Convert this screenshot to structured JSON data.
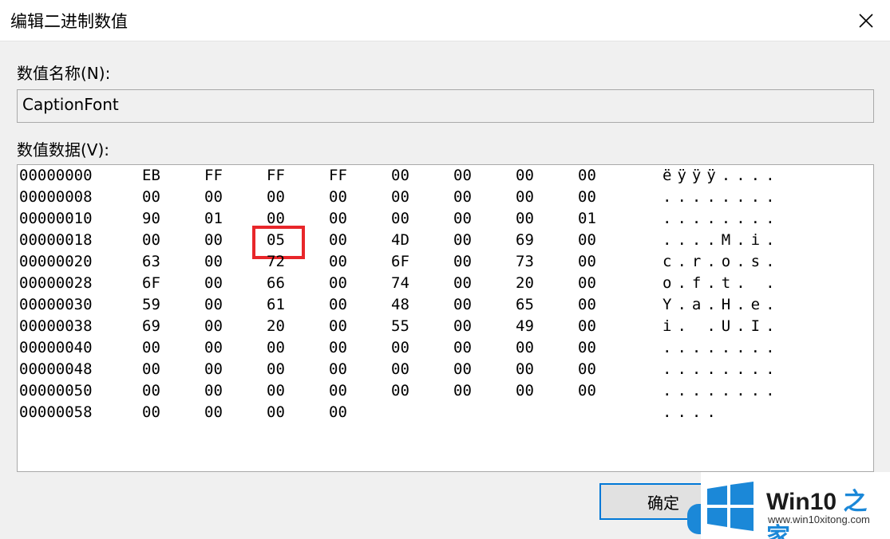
{
  "window": {
    "title": "编辑二进制数值"
  },
  "value_name": {
    "label": "数值名称(N):",
    "value": "CaptionFont"
  },
  "value_data": {
    "label": "数值数据(V):"
  },
  "hex_rows": [
    {
      "addr": "00000000",
      "bytes": [
        "EB",
        "FF",
        "FF",
        "FF",
        "00",
        "00",
        "00",
        "00"
      ],
      "ascii": "ëÿÿÿ...."
    },
    {
      "addr": "00000008",
      "bytes": [
        "00",
        "00",
        "00",
        "00",
        "00",
        "00",
        "00",
        "00"
      ],
      "ascii": "........"
    },
    {
      "addr": "00000010",
      "bytes": [
        "90",
        "01",
        "00",
        "00",
        "00",
        "00",
        "00",
        "01"
      ],
      "ascii": "........"
    },
    {
      "addr": "00000018",
      "bytes": [
        "00",
        "00",
        "05",
        "00",
        "4D",
        "00",
        "69",
        "00"
      ],
      "ascii": "....M.i."
    },
    {
      "addr": "00000020",
      "bytes": [
        "63",
        "00",
        "72",
        "00",
        "6F",
        "00",
        "73",
        "00"
      ],
      "ascii": "c.r.o.s."
    },
    {
      "addr": "00000028",
      "bytes": [
        "6F",
        "00",
        "66",
        "00",
        "74",
        "00",
        "20",
        "00"
      ],
      "ascii": "o.f.t. ."
    },
    {
      "addr": "00000030",
      "bytes": [
        "59",
        "00",
        "61",
        "00",
        "48",
        "00",
        "65",
        "00"
      ],
      "ascii": "Y.a.H.e."
    },
    {
      "addr": "00000038",
      "bytes": [
        "69",
        "00",
        "20",
        "00",
        "55",
        "00",
        "49",
        "00"
      ],
      "ascii": "i. .U.I."
    },
    {
      "addr": "00000040",
      "bytes": [
        "00",
        "00",
        "00",
        "00",
        "00",
        "00",
        "00",
        "00"
      ],
      "ascii": "........"
    },
    {
      "addr": "00000048",
      "bytes": [
        "00",
        "00",
        "00",
        "00",
        "00",
        "00",
        "00",
        "00"
      ],
      "ascii": "........"
    },
    {
      "addr": "00000050",
      "bytes": [
        "00",
        "00",
        "00",
        "00",
        "00",
        "00",
        "00",
        "00"
      ],
      "ascii": "........"
    },
    {
      "addr": "00000058",
      "bytes": [
        "00",
        "00",
        "00",
        "00"
      ],
      "ascii": "...."
    }
  ],
  "buttons": {
    "ok": "确定"
  },
  "watermark": {
    "title_prefix": "Win10 ",
    "title_accent": "之家",
    "url": "www.win10xitong.com"
  },
  "colors": {
    "highlight": "#e8262a",
    "focus_border": "#0078d7",
    "brand_blue": "#1b88d8"
  },
  "icons": {
    "close": "close-icon",
    "logo": "windows-logo-icon"
  }
}
